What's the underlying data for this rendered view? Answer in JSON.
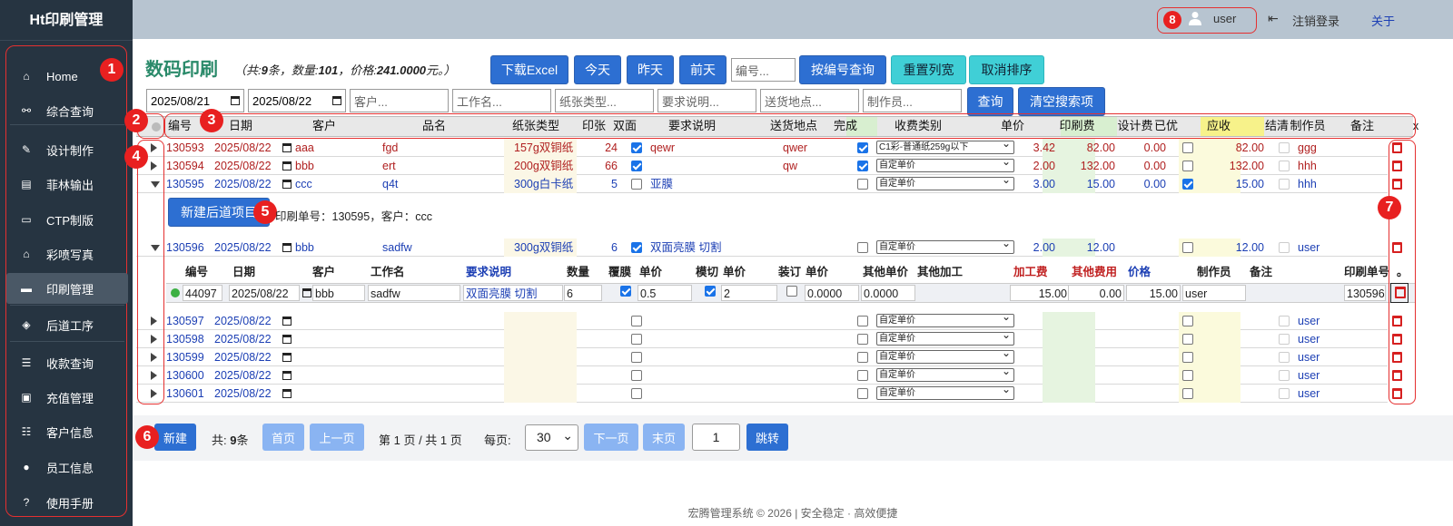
{
  "app": {
    "title": "Ht印刷管理"
  },
  "sidebar": {
    "items": [
      {
        "label": "Home",
        "icon": "home-icon"
      },
      {
        "label": "综合查询",
        "icon": "binoculars-icon"
      },
      {
        "label": "设计制作",
        "icon": "edit-icon"
      },
      {
        "label": "菲林输出",
        "icon": "document-icon"
      },
      {
        "label": "CTP制版",
        "icon": "folder-icon"
      },
      {
        "label": "彩喷写真",
        "icon": "bank-icon"
      },
      {
        "label": "印刷管理",
        "icon": "printer-icon"
      },
      {
        "label": "后道工序",
        "icon": "layers-icon"
      },
      {
        "label": "收款查询",
        "icon": "list-icon"
      },
      {
        "label": "充值管理",
        "icon": "money-icon"
      },
      {
        "label": "客户信息",
        "icon": "user-list-icon"
      },
      {
        "label": "员工信息",
        "icon": "user-icon"
      },
      {
        "label": "使用手册",
        "icon": "help-icon"
      }
    ]
  },
  "topbar": {
    "user": "user",
    "logout": "注销登录",
    "about": "关于"
  },
  "badges": [
    "1",
    "2",
    "3",
    "4",
    "5",
    "6",
    "7",
    "8"
  ],
  "page": {
    "title": "数码印刷",
    "summary_prefix": "（共:",
    "count": "9",
    "summary_mid1": "条，数量:",
    "qty": "101",
    "summary_mid2": "，价格:",
    "price": "241.0000",
    "summary_suffix": "元。）"
  },
  "toolbar": {
    "download": "下载Excel",
    "today": "今天",
    "yesterday": "昨天",
    "daybefore": "前天",
    "code_placeholder": "编号...",
    "code_query": "按编号查询",
    "reset_width": "重置列宽",
    "cancel_sort": "取消排序",
    "query": "查询",
    "clear": "清空搜索项"
  },
  "filters": {
    "date_from": "2025/08/21",
    "date_to": "2025/08/22",
    "customer": "客户...",
    "jobname": "工作名...",
    "paper": "纸张类型...",
    "req": "要求说明...",
    "place": "送货地点...",
    "maker": "制作员..."
  },
  "columns": [
    "编号",
    "日期",
    "客户",
    "品名",
    "纸张类型",
    "印张",
    "双面",
    "要求说明",
    "送货地点",
    "完成",
    "收费类别",
    "单价",
    "印刷费",
    "设计费",
    "已优",
    "应收",
    "结清",
    "制作员",
    "备注",
    "x"
  ],
  "rows": [
    {
      "id": "130593",
      "date": "2025/08/22",
      "customer": "aaa",
      "name": "fgd",
      "paper": "157g双铜纸",
      "sheets": "24",
      "duplex": true,
      "req": "qewr",
      "place": "qwer",
      "done": true,
      "fee": "C1彩-普通纸259g以下",
      "unit": "3.42",
      "print": "82.00",
      "design": "0.00",
      "disc": false,
      "due": "82.00",
      "maker": "ggg",
      "style": "red"
    },
    {
      "id": "130594",
      "date": "2025/08/22",
      "customer": "bbb",
      "name": "ert",
      "paper": "200g双铜纸",
      "sheets": "66",
      "duplex": true,
      "req": "",
      "place": "qw",
      "done": true,
      "fee": "自定单价",
      "unit": "2.00",
      "print": "132.00",
      "design": "0.00",
      "disc": false,
      "due": "132.00",
      "maker": "hhh",
      "style": "red"
    },
    {
      "id": "130595",
      "date": "2025/08/22",
      "customer": "ccc",
      "name": "q4t",
      "paper": "300g白卡纸",
      "sheets": "5",
      "duplex": false,
      "req": "亚膜",
      "place": "",
      "done": false,
      "fee": "自定单价",
      "unit": "3.00",
      "print": "15.00",
      "design": "0.00",
      "disc": true,
      "due": "15.00",
      "maker": "hhh",
      "style": "blue"
    },
    {
      "id": "130596",
      "date": "2025/08/22",
      "customer": "bbb",
      "name": "sadfw",
      "paper": "300g双铜纸",
      "sheets": "6",
      "duplex": true,
      "req": "双面亮膜 切割",
      "place": "",
      "done": false,
      "fee": "自定单价",
      "unit": "2.00",
      "print": "12.00",
      "design": "",
      "disc": false,
      "due": "12.00",
      "maker": "user",
      "style": "blue"
    },
    {
      "id": "130597",
      "date": "2025/08/22",
      "customer": "",
      "name": "",
      "paper": "",
      "sheets": "",
      "duplex": false,
      "req": "",
      "place": "",
      "done": false,
      "fee": "自定单价",
      "unit": "",
      "print": "",
      "design": "",
      "disc": false,
      "due": "",
      "maker": "user",
      "style": "blue"
    },
    {
      "id": "130598",
      "date": "2025/08/22",
      "customer": "",
      "name": "",
      "paper": "",
      "sheets": "",
      "duplex": false,
      "req": "",
      "place": "",
      "done": false,
      "fee": "自定单价",
      "unit": "",
      "print": "",
      "design": "",
      "disc": false,
      "due": "",
      "maker": "user",
      "style": "blue"
    },
    {
      "id": "130599",
      "date": "2025/08/22",
      "customer": "",
      "name": "",
      "paper": "",
      "sheets": "",
      "duplex": false,
      "req": "",
      "place": "",
      "done": false,
      "fee": "自定单价",
      "unit": "",
      "print": "",
      "design": "",
      "disc": false,
      "due": "",
      "maker": "user",
      "style": "blue"
    },
    {
      "id": "130600",
      "date": "2025/08/22",
      "customer": "",
      "name": "",
      "paper": "",
      "sheets": "",
      "duplex": false,
      "req": "",
      "place": "",
      "done": false,
      "fee": "自定单价",
      "unit": "",
      "print": "",
      "design": "",
      "disc": false,
      "due": "",
      "maker": "user",
      "style": "blue"
    },
    {
      "id": "130601",
      "date": "2025/08/22",
      "customer": "",
      "name": "",
      "paper": "",
      "sheets": "",
      "duplex": false,
      "req": "",
      "place": "",
      "done": false,
      "fee": "自定单价",
      "unit": "",
      "print": "",
      "design": "",
      "disc": false,
      "due": "",
      "maker": "user",
      "style": "blue"
    }
  ],
  "expand1": {
    "button": "新建后道项目",
    "info": "印刷单号：130595，客户：ccc"
  },
  "sub": {
    "headers": [
      "编号",
      "日期",
      "客户",
      "工作名",
      "要求说明",
      "数量",
      "覆膜",
      "单价",
      "模切",
      "单价",
      "装订",
      "单价",
      "其他单价",
      "其他加工",
      "加工费",
      "其他费用",
      "价格",
      "制作员",
      "备注",
      "印刷单号",
      "。"
    ],
    "row": {
      "id": "44097",
      "date": "2025/08/22",
      "customer": "bbb",
      "job": "sadfw",
      "req": "双面亮膜 切割",
      "qty": "6",
      "film_price": "0.5",
      "die_price": "2",
      "bind_price": "0.0000",
      "other_price": "0.0000",
      "proc_fee": "15.00",
      "other_fee": "0.00",
      "price": "15.00",
      "maker": "user",
      "print_no": "130596"
    }
  },
  "pager": {
    "new": "新建",
    "total_label": "共:",
    "total": "9",
    "total_unit": "条",
    "first": "首页",
    "prev": "上一页",
    "pageinfo": "第 1 页 / 共 1 页",
    "perpage_label": "每页:",
    "perpage": "30",
    "next": "下一页",
    "last": "末页",
    "jump_value": "1",
    "jump": "跳转"
  },
  "footer": "宏腾管理系统 © 2026 | 安全稳定 · 高效便捷",
  "colors": {
    "sidebar": "#263441",
    "topbar": "#b7c4d0",
    "primary": "#2d6fd2",
    "teal": "#40cfd6",
    "accent_title": "#2a8a6a",
    "badge": "#e82020"
  }
}
